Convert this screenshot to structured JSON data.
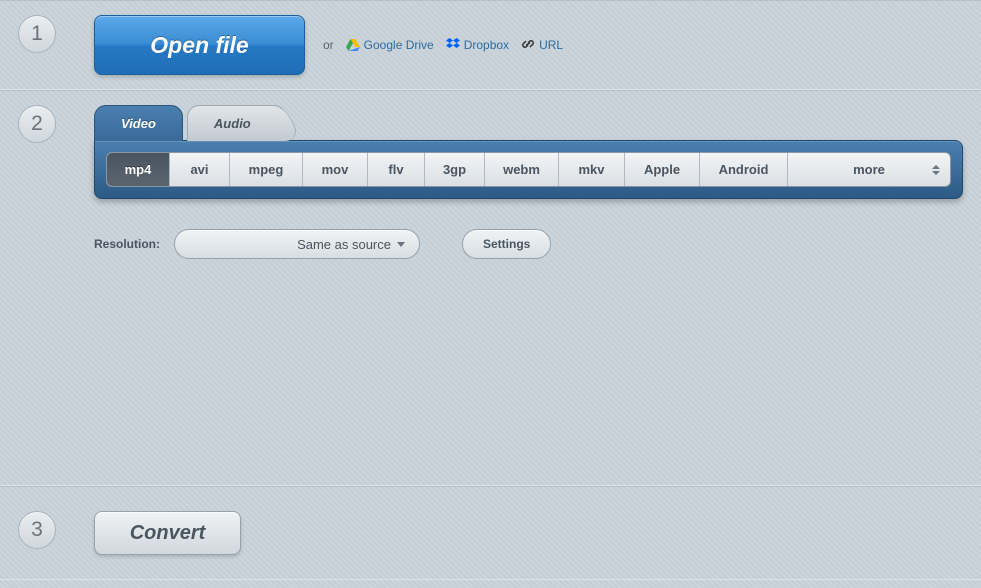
{
  "steps": {
    "one": "1",
    "two": "2",
    "three": "3"
  },
  "openFile": {
    "label": "Open file",
    "or": "or"
  },
  "sources": {
    "gdrive": "Google Drive",
    "dropbox": "Dropbox",
    "url": "URL"
  },
  "tabs": {
    "video": "Video",
    "audio": "Audio"
  },
  "formats": {
    "mp4": "mp4",
    "avi": "avi",
    "mpeg": "mpeg",
    "mov": "mov",
    "flv": "flv",
    "threegp": "3gp",
    "webm": "webm",
    "mkv": "mkv",
    "apple": "Apple",
    "android": "Android",
    "more": "more"
  },
  "resolution": {
    "label": "Resolution:",
    "value": "Same as source"
  },
  "settings": {
    "label": "Settings"
  },
  "convert": {
    "label": "Convert"
  }
}
